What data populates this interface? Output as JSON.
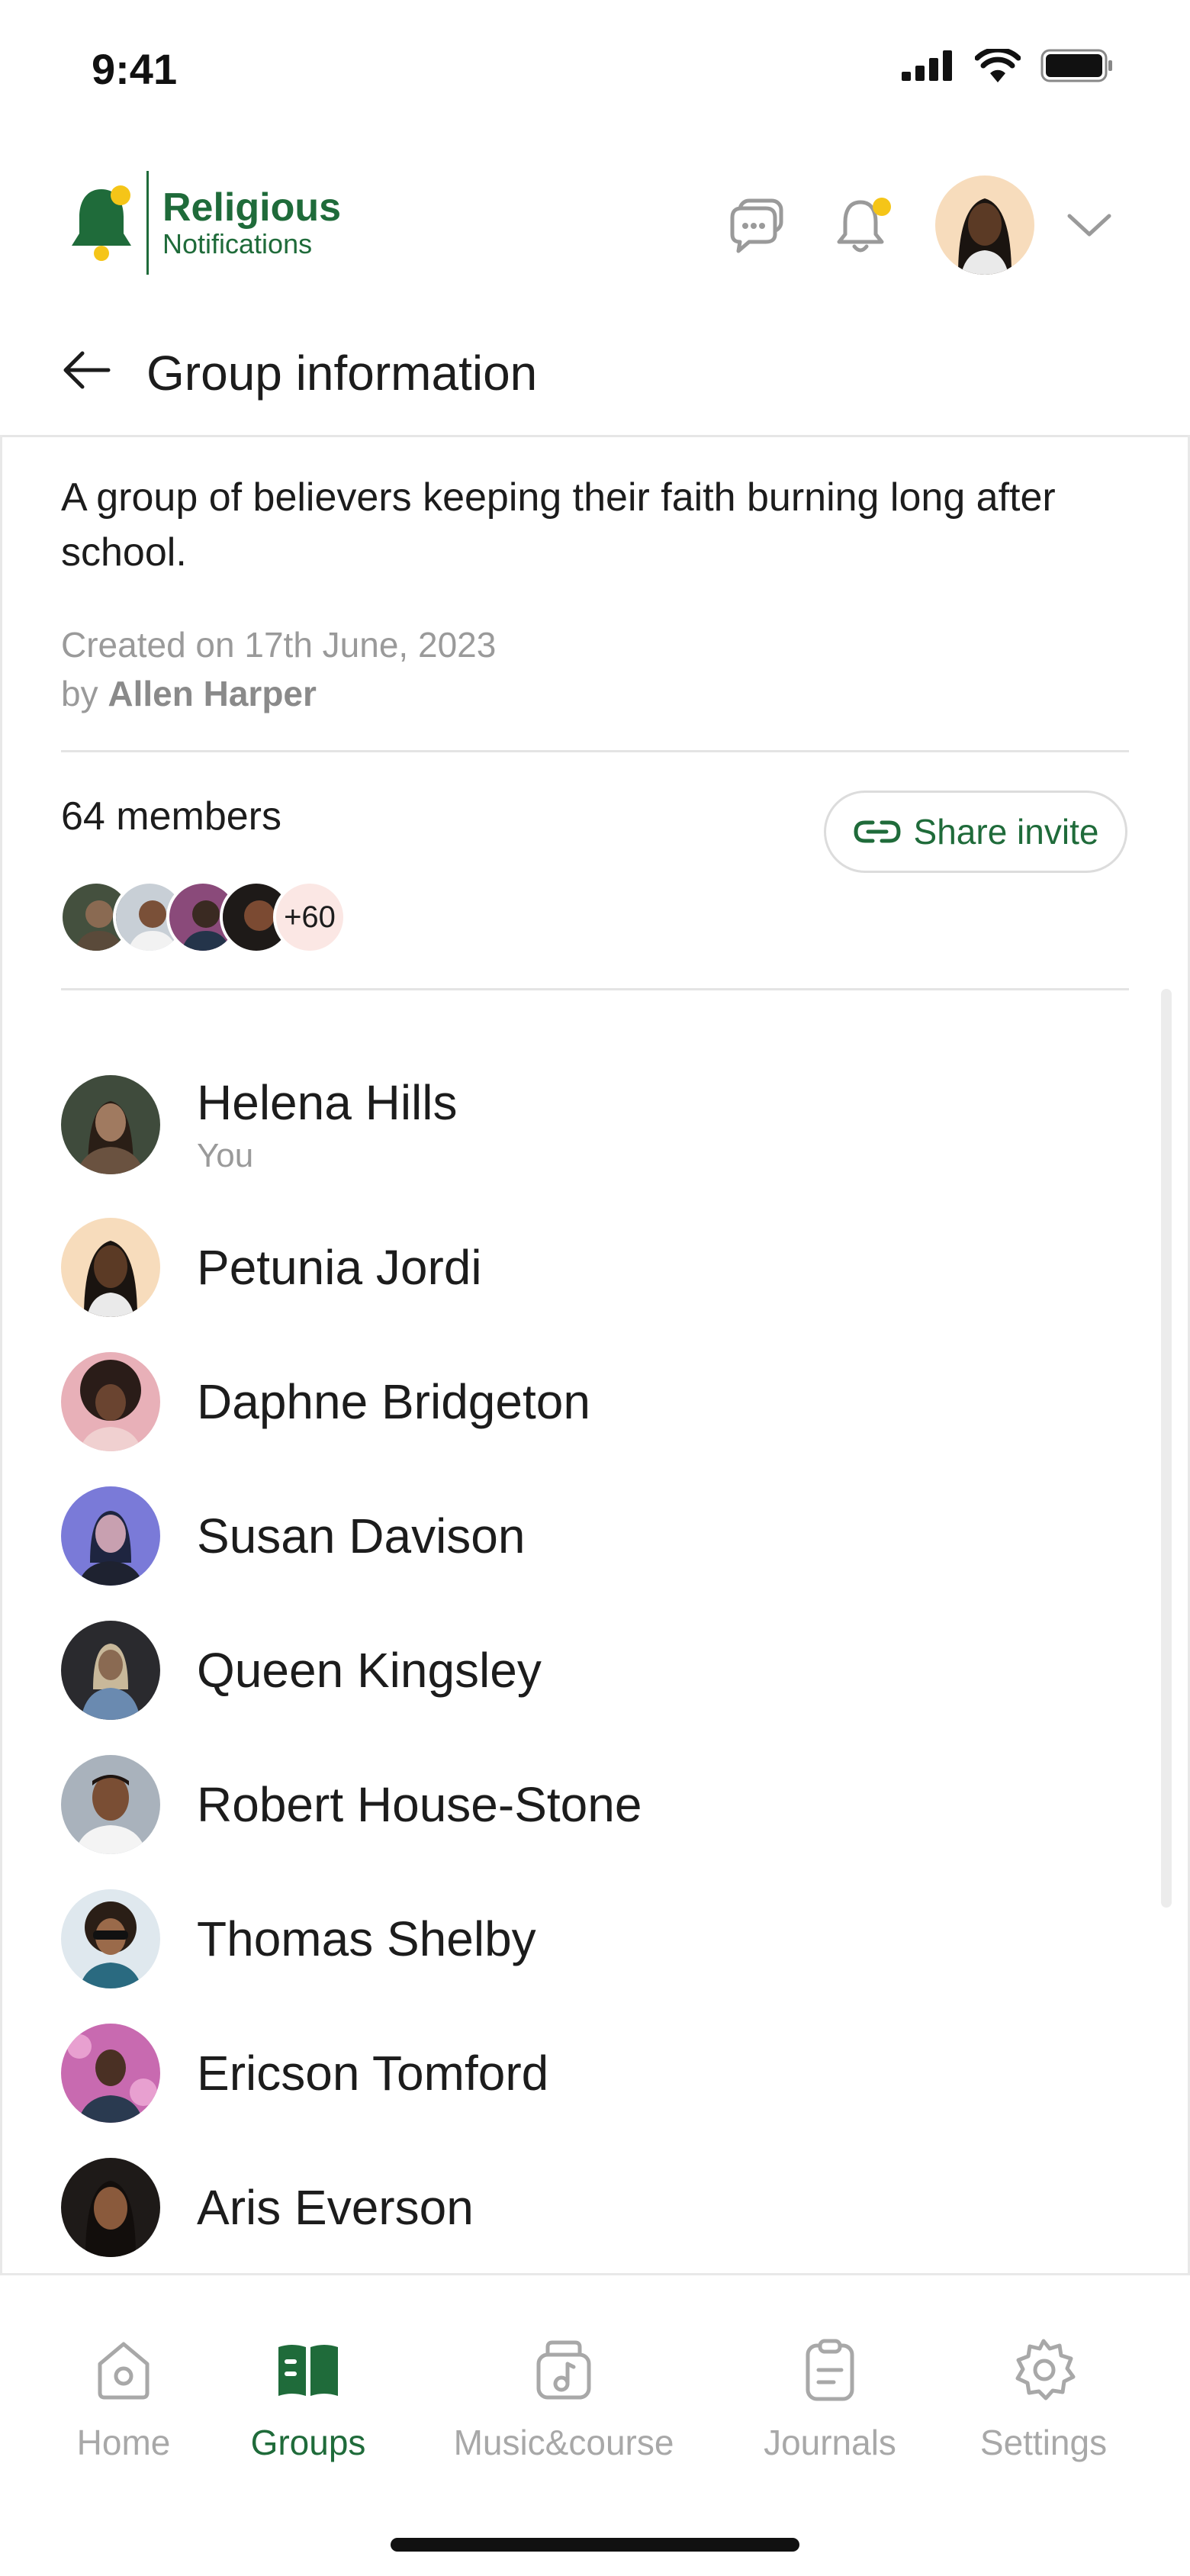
{
  "status_bar": {
    "time": "9:41"
  },
  "header": {
    "logo_title": "Religious",
    "logo_subtitle": "Notifications",
    "accent_color": "#1f6b3a",
    "notification_dot_color": "#f5c518"
  },
  "nav": {
    "title": "Group information"
  },
  "group": {
    "description": "A group of believers keeping their faith burning long after school.",
    "created_on": "Created on 17th June, 2023",
    "by_prefix": "by",
    "creator": "Allen Harper",
    "members_count": "64 members",
    "share_invite": "Share invite",
    "more_count": "+60"
  },
  "members": [
    {
      "name": "Helena Hills",
      "subtitle": "You"
    },
    {
      "name": "Petunia Jordi"
    },
    {
      "name": "Daphne Bridgeton"
    },
    {
      "name": "Susan Davison"
    },
    {
      "name": "Queen Kingsley"
    },
    {
      "name": "Robert House-Stone"
    },
    {
      "name": "Thomas Shelby"
    },
    {
      "name": "Ericson Tomford"
    },
    {
      "name": "Aris Everson"
    }
  ],
  "tabs": [
    {
      "label": "Home",
      "icon": "home-icon"
    },
    {
      "label": "Groups",
      "icon": "book-icon",
      "active": true
    },
    {
      "label": "Music&course",
      "icon": "music-icon"
    },
    {
      "label": "Journals",
      "icon": "clipboard-icon"
    },
    {
      "label": "Settings",
      "icon": "gear-icon"
    }
  ]
}
